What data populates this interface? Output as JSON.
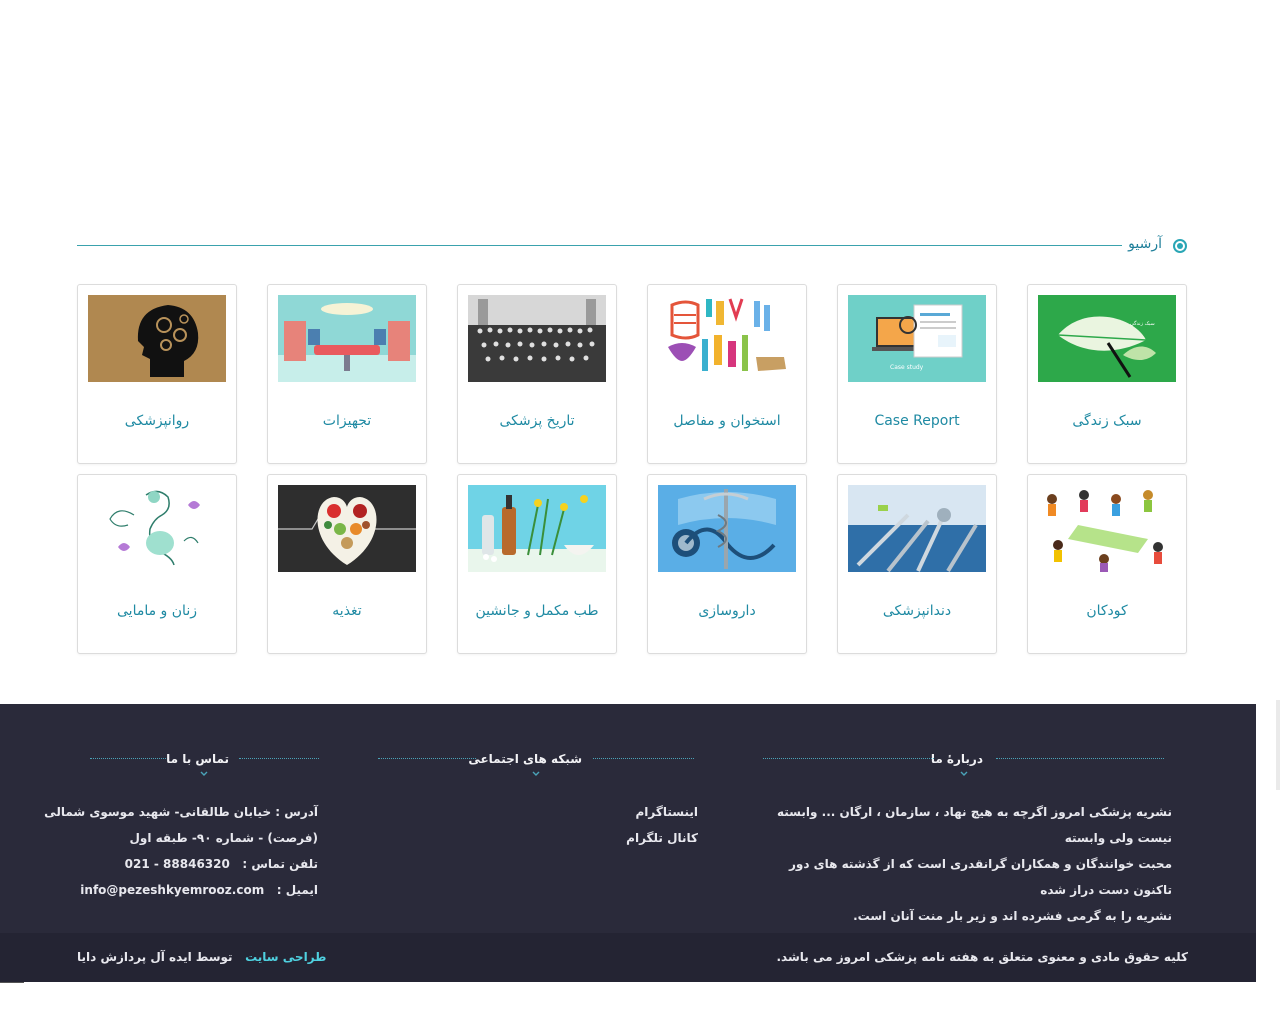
{
  "archive": {
    "title": "آرشیو"
  },
  "cards": [
    {
      "label": "سبک زندگی",
      "image": "leaf-on-green"
    },
    {
      "label": "Case Report",
      "image": "case-study-laptop"
    },
    {
      "label": "استخوان و مفاصل",
      "image": "colorful-bones"
    },
    {
      "label": "تاریخ پزشکی",
      "image": "historical-group-photo"
    },
    {
      "label": "تجهیزات",
      "image": "operating-room"
    },
    {
      "label": "روانپزشکی",
      "image": "gear-head"
    },
    {
      "label": "کودکان",
      "image": "children-playing"
    },
    {
      "label": "دندانپزشکی",
      "image": "dental-tools"
    },
    {
      "label": "داروسازی",
      "image": "caduceus-stethoscope"
    },
    {
      "label": "طب مکمل و جانشین",
      "image": "herbal-medicine"
    },
    {
      "label": "تغذیه",
      "image": "heart-vegetables"
    },
    {
      "label": "زنان و مامایی",
      "image": "pregnant-woman-sketch"
    }
  ],
  "footer": {
    "about": {
      "title": "دربارهٔ ما",
      "lines": [
        "نشریه پزشکی امروز اگرچه به هیچ نهاد ، سازمان ، ارگان ... وابسته نیست ولی وابسته",
        "محبت خوانندگان و همکاران گرانقدری است که از گذشته های دور تاکنون دست دراز شده",
        "نشریه را به گرمی فشرده اند و زیر بار منت آنان است."
      ]
    },
    "social": {
      "title": "شبکه های اجتماعی",
      "items": [
        "اینستاگرام",
        "کانال تلگرام"
      ]
    },
    "contact": {
      "title": "تماس با ما",
      "address_line1": "آدرس : خیابان طالقانی- شهید موسوی شمالی",
      "address_line2": "(فرصت) - شماره ۹۰- طبقه اول",
      "phone_label": "تلفن تماس :",
      "phone_value": "021 - 88846320",
      "email_label": "ایمیل :",
      "email_value": "info@pezeshkyemrooz.com"
    }
  },
  "bottom": {
    "copyright": "کلیه حقوق مادی و معنوی متعلق به هفته نامه پزشکی امروز می باشد.",
    "design_link": "طراحی سایت",
    "design_by": "توسط ایده آل پردازش دایا"
  },
  "colors": {
    "accent": "#2aa6b5",
    "footer_bg": "#2a2a3a",
    "bottom_bg": "#242433",
    "link": "#4fd1e0"
  }
}
